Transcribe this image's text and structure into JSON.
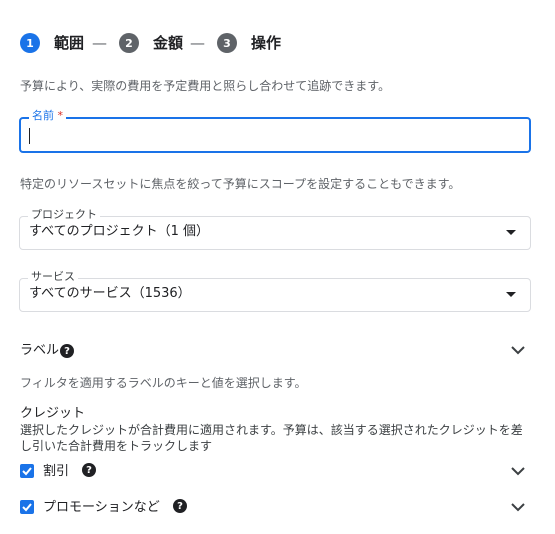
{
  "colors": {
    "accent": "#1a73e8",
    "step_inactive": "#5f6368",
    "checkbox": "#1a73e8"
  },
  "stepper": {
    "steps": [
      {
        "number": "1",
        "label": "範囲"
      },
      {
        "number": "2",
        "label": "金額"
      },
      {
        "number": "3",
        "label": "操作"
      }
    ],
    "separator": "—"
  },
  "intro_text": "予算により、実際の費用を予定費用と照らし合わせて追跡できます。",
  "name_field": {
    "label": "名前",
    "required_mark": "*",
    "value": ""
  },
  "scope_text": "特定のリソースセットに焦点を絞って予算にスコープを設定することもできます。",
  "project_select": {
    "label": "プロジェクト",
    "value": "すべてのプロジェクト（1 個）"
  },
  "service_select": {
    "label": "サービス",
    "value": "すべてのサービス（1536）"
  },
  "labels_section": {
    "title": "ラベル",
    "help_icon": "help-icon",
    "description": "フィルタを適用するラベルのキーと値を選択します。"
  },
  "credits_section": {
    "title": "クレジット",
    "description_line1": "選択したクレジットが合計費用に適用されます。予算は、該当する選択されたクレジットを差",
    "description_line2": "し引いた合計費用をトラックします",
    "items": [
      {
        "label": "割引",
        "checked": true
      },
      {
        "label": "プロモーションなど",
        "checked": true
      }
    ]
  }
}
